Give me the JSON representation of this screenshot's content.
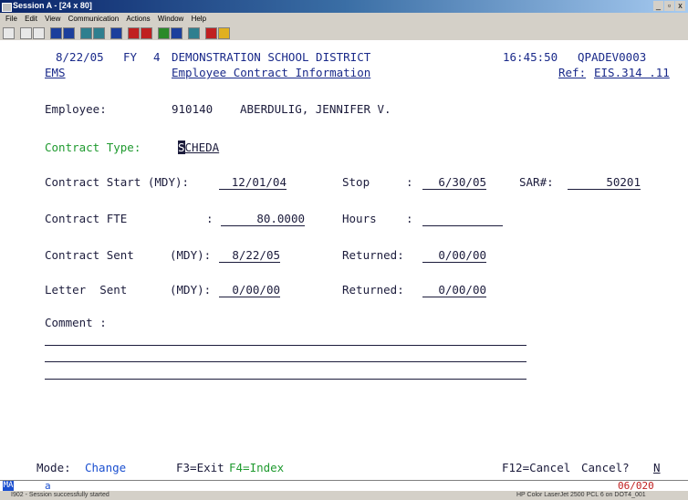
{
  "window": {
    "title": "Session A - [24 x 80]",
    "minimize_label": "_",
    "restore_label": "▫",
    "close_label": "x"
  },
  "menu": [
    "File",
    "Edit",
    "View",
    "Communication",
    "Actions",
    "Window",
    "Help"
  ],
  "header": {
    "date": "8/22/05",
    "fy_label": "FY",
    "fy_value": "4",
    "district": "DEMONSTRATION SCHOOL DISTRICT",
    "time": "16:45:50",
    "system": "QPADEV0003",
    "app": "EMS",
    "screen_title": "Employee Contract Information",
    "ref_label": "Ref:",
    "ref_value": "EIS.314 .11"
  },
  "employee": {
    "label": "Employee:",
    "number": "910140",
    "name": "ABERDULIG, JENNIFER V."
  },
  "contract_type": {
    "label": "Contract Type:",
    "cursor_char": "S",
    "value_rest": "CHEDA"
  },
  "contract_start": {
    "label": "Contract Start (MDY):",
    "value": "12/01/04",
    "stop_label": "Stop",
    "stop_sep": ":",
    "stop_value": "6/30/05",
    "sar_label": "SAR#:",
    "sar_value": "50201"
  },
  "contract_fte": {
    "label": "Contract FTE",
    "sep": ":",
    "value": "80.0000",
    "hours_label": "Hours",
    "hours_sep": ":",
    "hours_value": ""
  },
  "contract_sent": {
    "label": "Contract Sent",
    "mdy": "(MDY):",
    "value": "8/22/05",
    "returned_label": "Returned:",
    "returned_value": "0/00/00"
  },
  "letter_sent": {
    "label": "Letter  Sent",
    "mdy": "(MDY):",
    "value": "0/00/00",
    "returned_label": "Returned:",
    "returned_value": "0/00/00"
  },
  "comment": {
    "label": "Comment :"
  },
  "footer": {
    "mode_label": "Mode:",
    "mode_value": "Change",
    "f3": "F3=Exit",
    "f4": "F4=Index",
    "f12": "F12=Cancel",
    "cancel_q": "Cancel?",
    "cancel_value": "N"
  },
  "oia": {
    "ma": "MA",
    "session": "a",
    "cursor_pos": "06/020"
  },
  "statusbar": {
    "message": "I902 - Session successfully started",
    "printer": "HP Color LaserJet 2500 PCL 6 on DOT4_001"
  }
}
